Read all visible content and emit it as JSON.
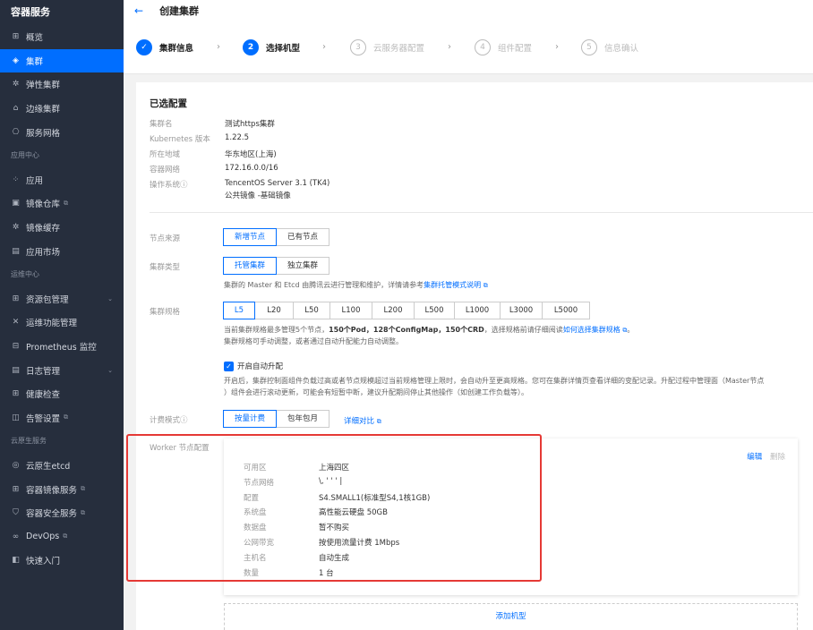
{
  "sidebar": {
    "title": "容器服务",
    "items": [
      {
        "label": "概览",
        "icon": "grid-icon",
        "glyph": "⊞"
      },
      {
        "label": "集群",
        "icon": "cluster-icon",
        "glyph": "◈",
        "active": true
      },
      {
        "label": "弹性集群",
        "icon": "elastic-cluster-icon",
        "glyph": "✲"
      },
      {
        "label": "边缘集群",
        "icon": "edge-cluster-icon",
        "glyph": "⌂"
      },
      {
        "label": "服务网格",
        "icon": "service-mesh-icon",
        "glyph": "⎔"
      }
    ],
    "group1": "应用中心",
    "items2": [
      {
        "label": "应用",
        "icon": "app-icon",
        "glyph": "⁘"
      },
      {
        "label": "镜像仓库",
        "icon": "image-registry-icon",
        "glyph": "▣",
        "ext": true
      },
      {
        "label": "镜像缓存",
        "icon": "image-cache-icon",
        "glyph": "✲"
      },
      {
        "label": "应用市场",
        "icon": "app-market-icon",
        "glyph": "▤"
      }
    ],
    "group2": "运维中心",
    "items3": [
      {
        "label": "资源包管理",
        "icon": "resource-package-icon",
        "glyph": "⊞",
        "caret": true
      },
      {
        "label": "运维功能管理",
        "icon": "ops-feature-icon",
        "glyph": "✕"
      },
      {
        "label": "Prometheus 监控",
        "icon": "prometheus-icon",
        "glyph": "⊟"
      },
      {
        "label": "日志管理",
        "icon": "log-icon",
        "glyph": "▤",
        "caret": true
      },
      {
        "label": "健康检查",
        "icon": "health-check-icon",
        "glyph": "⊞"
      },
      {
        "label": "告警设置",
        "icon": "alarm-icon",
        "glyph": "◫",
        "ext": true
      }
    ],
    "group3": "云原生服务",
    "items4": [
      {
        "label": "云原生etcd",
        "icon": "etcd-icon",
        "glyph": "◎"
      },
      {
        "label": "容器镜像服务",
        "icon": "image-service-icon",
        "glyph": "⊞",
        "ext": true
      },
      {
        "label": "容器安全服务",
        "icon": "security-icon",
        "glyph": "⛉",
        "ext": true
      },
      {
        "label": "DevOps",
        "icon": "devops-icon",
        "glyph": "∞",
        "ext": true
      },
      {
        "label": "快速入门",
        "icon": "quickstart-icon",
        "glyph": "◧"
      }
    ]
  },
  "header": {
    "back": "←",
    "title": "创建集群"
  },
  "steps": [
    {
      "num": "✓",
      "label": "集群信息",
      "state": "done"
    },
    {
      "num": "2",
      "label": "选择机型",
      "state": "cur"
    },
    {
      "num": "3",
      "label": "云服务器配置",
      "state": "todo"
    },
    {
      "num": "4",
      "label": "组件配置",
      "state": "todo"
    },
    {
      "num": "5",
      "label": "信息确认",
      "state": "todo"
    }
  ],
  "step_sep": "›",
  "selected": {
    "title": "已选配置",
    "rows": [
      {
        "k": "集群名",
        "v": [
          "测试https集群"
        ]
      },
      {
        "k": "Kubernetes 版本",
        "v": [
          "1.22.5"
        ]
      },
      {
        "k": "所在地域",
        "v": [
          "华东地区(上海)"
        ]
      },
      {
        "k": "容器网络",
        "v": [
          "172.16.0.0/16"
        ]
      },
      {
        "k": "操作系统",
        "v": [
          "TencentOS Server 3.1 (TK4)",
          "公共镜像 -基础镜像"
        ],
        "info": "ⓘ"
      }
    ]
  },
  "node_source": {
    "label": "节点来源",
    "options": [
      "新增节点",
      "已有节点"
    ],
    "selected": 0
  },
  "cluster_type": {
    "label": "集群类型",
    "options": [
      "托管集群",
      "独立集群"
    ],
    "selected": 0,
    "hint": "集群的 Master 和 Etcd 由腾讯云进行管理和维护，详情请参考",
    "hint_link": "集群托管模式说明"
  },
  "cluster_spec": {
    "label": "集群规格",
    "options": [
      "L5",
      "L20",
      "L50",
      "L100",
      "L200",
      "L500",
      "L1000",
      "L3000",
      "L5000"
    ],
    "selected": 0,
    "hint_a": "当前集群规格最多管理5个节点，",
    "hint_b": "150个Pod，128个ConfigMap，150个CRD",
    "hint_c": "，选择规格前请仔细阅读",
    "hint_link": "如何选择集群规格",
    "hint_end": "。",
    "hint_line2": "集群规格可手动调整，或者通过自动升配能力自动调整。"
  },
  "auto_upgrade": {
    "label": "开启自动升配",
    "check": "✓",
    "hint_line1": "开启后，集群控制面组件负载过高或者节点规模超过当前规格管理上限时，会自动升至更高规格。您可在集群详情页查看详细的变配记录。升配过程中管理面（Master节点",
    "hint_line2": "）组件会进行滚动更新，可能会有短暂中断，建议升配期间停止其他操作（如创建工作负载等）。"
  },
  "billing": {
    "label": "计费模式",
    "info": "ⓘ",
    "options": [
      "按量计费",
      "包年包月"
    ],
    "selected": 0,
    "link": "详细对比"
  },
  "worker": {
    "label": "Worker 节点配置",
    "edit": "编辑",
    "delete": "删除",
    "rows": [
      {
        "k": "可用区",
        "v": "上海四区"
      },
      {
        "k": "节点网络",
        "v": "\\,      '  '   ' |"
      },
      {
        "k": "配置",
        "v": "S4.SMALL1(标准型S4,1核1GB)"
      },
      {
        "k": "系统盘",
        "v": "高性能云硬盘 50GB"
      },
      {
        "k": "数据盘",
        "v": "暂不购买"
      },
      {
        "k": "公网带宽",
        "v": "按使用流量计费 1Mbps"
      },
      {
        "k": "主机名",
        "v": "自动生成"
      },
      {
        "k": "数量",
        "v": "1 台"
      }
    ],
    "add": "添加机型"
  },
  "ext_glyph": "⧉",
  "colors": {
    "primary": "#006eff",
    "sidebar_bg": "#262e3d",
    "annotation": "#e53935"
  }
}
